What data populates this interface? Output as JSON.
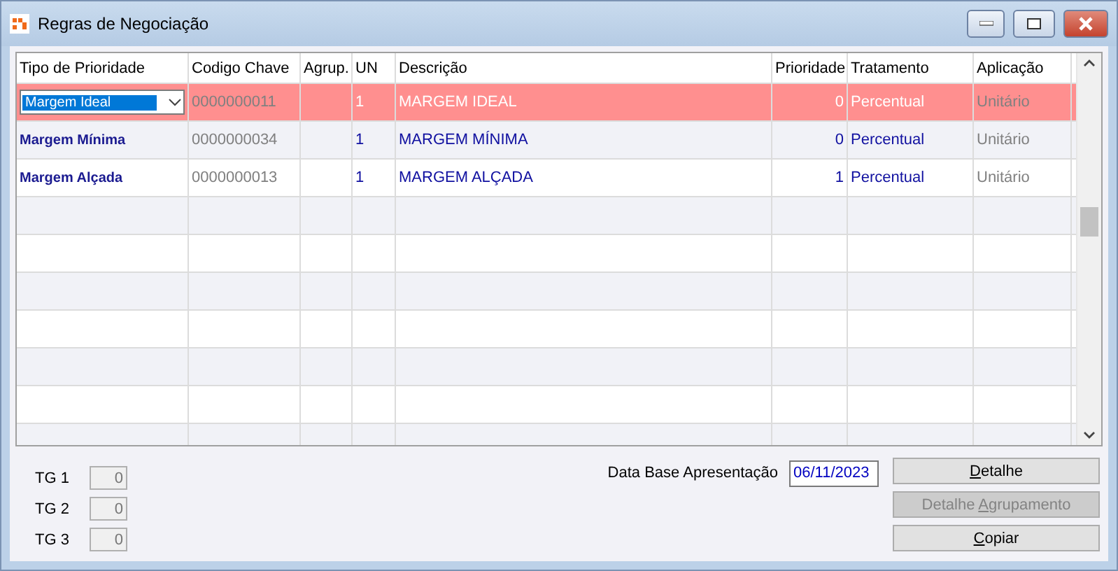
{
  "window": {
    "title": "Regras de Negociação"
  },
  "table": {
    "columns": [
      "Tipo de Prioridade",
      "Codigo Chave",
      "Agrup.",
      "UN",
      "Descrição",
      "Prioridade",
      "Tratamento",
      "Aplicação"
    ],
    "rows": [
      {
        "selected": true,
        "cells": [
          "Margem Ideal",
          "0000000011",
          "",
          "1",
          "MARGEM IDEAL",
          "0",
          "Percentual",
          "Unitário"
        ]
      },
      {
        "selected": false,
        "cells": [
          "Margem Mínima",
          "0000000034",
          "",
          "1",
          "MARGEM MÍNIMA",
          "0",
          "Percentual",
          "Unitário"
        ]
      },
      {
        "selected": false,
        "cells": [
          "Margem Alçada",
          "0000000013",
          "",
          "1",
          "MARGEM ALÇADA",
          "1",
          "Percentual",
          "Unitário"
        ]
      }
    ]
  },
  "totals": [
    {
      "label": "TG 1",
      "value": "0"
    },
    {
      "label": "TG 2",
      "value": "0"
    },
    {
      "label": "TG 3",
      "value": "0"
    }
  ],
  "date_field": {
    "label": "Data Base Apresentação",
    "value": "06/11/2023"
  },
  "buttons": [
    {
      "disabled": false,
      "label_parts": [
        {
          "text": "D",
          "underlined": true
        },
        {
          "text": "etalhe",
          "underlined": false
        }
      ]
    },
    {
      "disabled": true,
      "label_parts": [
        {
          "text": "Detalhe ",
          "underlined": false
        },
        {
          "text": "A",
          "underlined": true
        },
        {
          "text": "grupamento",
          "underlined": false
        }
      ]
    },
    {
      "disabled": false,
      "label_parts": [
        {
          "text": "C",
          "underlined": true
        },
        {
          "text": "opiar",
          "underlined": false
        }
      ]
    }
  ]
}
